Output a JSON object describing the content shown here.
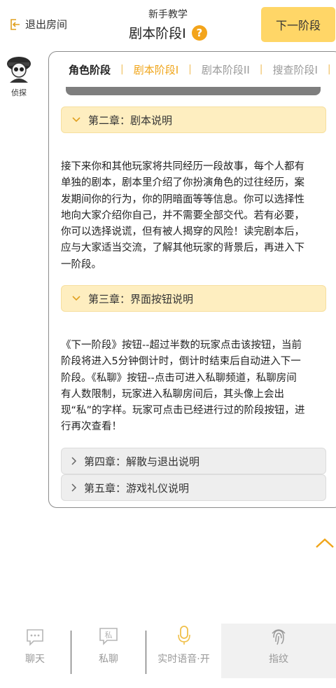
{
  "header": {
    "exit_label": "退出房间",
    "subtitle": "新手教学",
    "title": "剧本阶段I",
    "help_symbol": "?",
    "next_stage_label": "下一阶段"
  },
  "avatar": {
    "label": "侦探"
  },
  "tabs": [
    {
      "label": "角色阶段",
      "state": "done"
    },
    {
      "label": "剧本阶段I",
      "state": "current"
    },
    {
      "label": "剧本阶段II",
      "state": "locked"
    },
    {
      "label": "搜查阶段I",
      "state": "locked"
    }
  ],
  "tab_separator": "|",
  "chapters": {
    "ch2": {
      "title": "第二章：剧本说明",
      "expanded": true
    },
    "ch2_lines": [
      "接下来你和其他玩家将共同经历一段故事，每个人都有",
      "单独的剧本，剧本里介绍了你扮演角色的过往经历，案",
      "发期间你的行为，你的阴暗面等等信息。你可以选择性",
      "地向大家介绍你自己，并不需要全部交代。若有必要，",
      "你可以选择说谎，但有被人揭穿的风险！读完剧本后，",
      "应与大家适当交流，了解其他玩家的背景后，再进入下",
      "一阶段。"
    ],
    "ch3": {
      "title": "第三章：界面按钮说明",
      "expanded": true
    },
    "ch3_lines": [
      "《下一阶段》按钮--超过半数的玩家点击该按钮，当前",
      "阶段将进入5分钟倒计时，倒计时结束后自动进入下一",
      "阶段。《私聊》按钮--点击可进入私聊频道，私聊房间",
      "有人数限制，玩家进入私聊房间后，其头像上会出",
      "现“私”的字样。玩家可点击已经进行过的阶段按钮，进",
      "行再次查看！"
    ],
    "ch4": {
      "title": "第四章：解散与退出说明",
      "expanded": false
    },
    "ch5": {
      "title": "第五章：游戏礼仪说明",
      "expanded": false
    }
  },
  "bottom_bar": {
    "chat": "聊天",
    "private_chat": "私聊",
    "private_badge": "私",
    "voice": "实时语音·开",
    "fingerprint": "指纹"
  },
  "colors": {
    "accent": "#f0a51a",
    "button_bg": "#ffd667",
    "chapter_open_bg": "#feeec0",
    "chapter_closed_bg": "#eeeeee"
  }
}
